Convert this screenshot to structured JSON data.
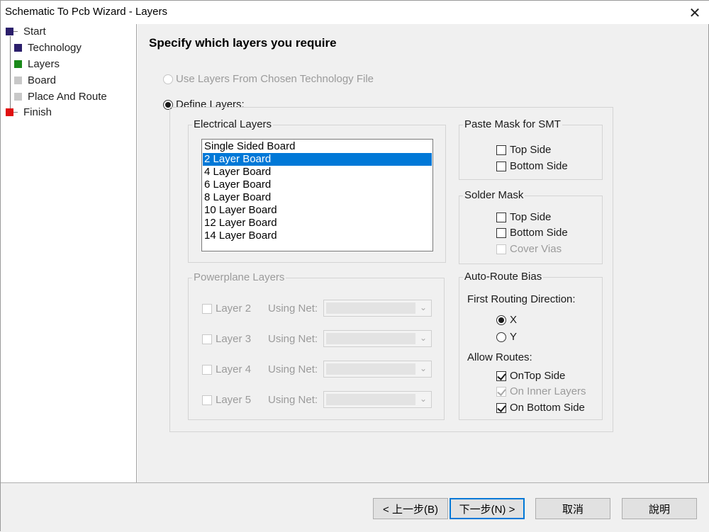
{
  "window": {
    "title": "Schematic To Pcb Wizard - Layers",
    "close_glyph": "✕"
  },
  "tree": {
    "items": [
      {
        "label": "Start",
        "color": "#2b1e6b"
      },
      {
        "label": "Technology",
        "color": "#2b1e6b"
      },
      {
        "label": "Layers",
        "color": "#1a8a1a"
      },
      {
        "label": "Board",
        "color": "#c8c8c8"
      },
      {
        "label": "Place And Route",
        "color": "#c8c8c8"
      },
      {
        "label": "Finish",
        "color": "#e01010"
      }
    ]
  },
  "main": {
    "heading": "Specify which layers you require",
    "use_tech_file_label": "Use Layers From Chosen Technology File",
    "define_layers_label": "Define Layers:",
    "electrical": {
      "title": "Electrical Layers",
      "options": [
        "Single Sided Board",
        "2 Layer Board",
        "4 Layer Board",
        "6 Layer Board",
        "8 Layer Board",
        "10 Layer Board",
        "12 Layer Board",
        "14 Layer Board"
      ],
      "selected": "2 Layer Board"
    },
    "powerplane": {
      "title": "Powerplane Layers",
      "using_net_label": "Using Net:",
      "layers": [
        "Layer 2",
        "Layer 3",
        "Layer 4",
        "Layer 5"
      ]
    },
    "paste_mask": {
      "title": "Paste Mask for SMT",
      "top": "Top Side",
      "bottom": "Bottom Side"
    },
    "solder_mask": {
      "title": "Solder Mask",
      "top": "Top Side",
      "bottom": "Bottom Side",
      "cover_vias": "Cover Vias"
    },
    "auto_route": {
      "title": "Auto-Route Bias",
      "first_direction_label": "First Routing Direction:",
      "x_label": "X",
      "y_label": "Y",
      "allow_routes_label": "Allow Routes:",
      "ontop": "OnTop Side",
      "inner": "On Inner Layers",
      "bottom": "On Bottom Side"
    }
  },
  "buttons": {
    "back": "< 上一步(B)",
    "next": "下一步(N) >",
    "cancel": "取消",
    "help": "說明"
  }
}
